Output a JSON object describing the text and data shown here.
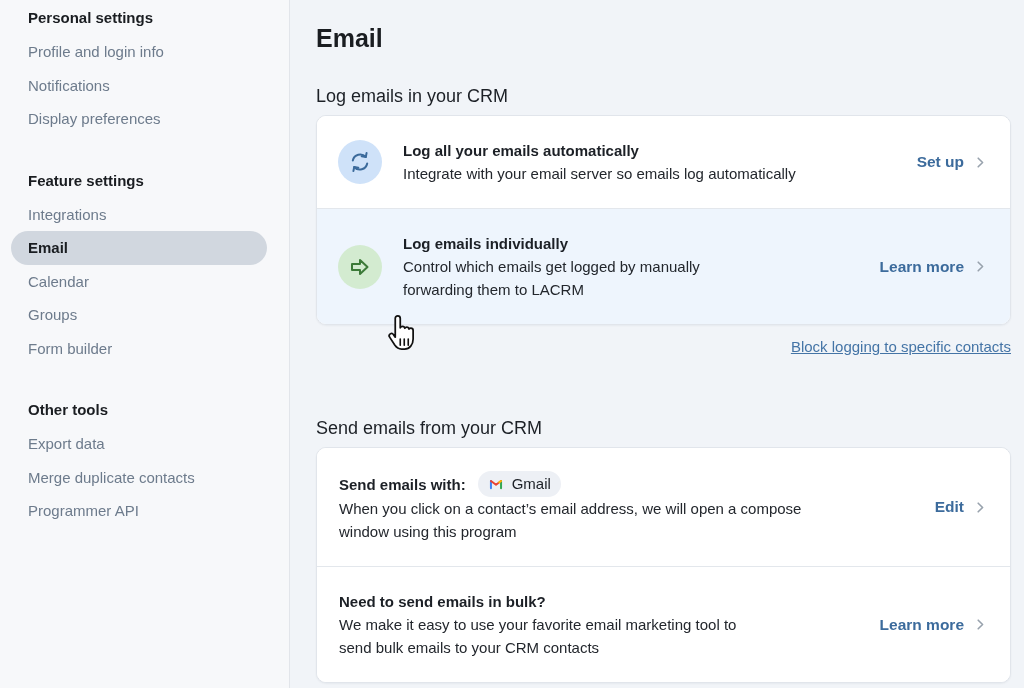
{
  "sidebar": {
    "groups": [
      {
        "heading": "Personal settings",
        "items": [
          {
            "label": "Profile and login info",
            "selected": false
          },
          {
            "label": "Notifications",
            "selected": false
          },
          {
            "label": "Display preferences",
            "selected": false
          }
        ]
      },
      {
        "heading": "Feature settings",
        "items": [
          {
            "label": "Integrations",
            "selected": false
          },
          {
            "label": "Email",
            "selected": true
          },
          {
            "label": "Calendar",
            "selected": false
          },
          {
            "label": "Groups",
            "selected": false
          },
          {
            "label": "Form builder",
            "selected": false
          }
        ]
      },
      {
        "heading": "Other tools",
        "items": [
          {
            "label": "Export data",
            "selected": false
          },
          {
            "label": "Merge duplicate contacts",
            "selected": false
          },
          {
            "label": "Programmer API",
            "selected": false
          }
        ]
      }
    ]
  },
  "page_title": "Email",
  "sections": [
    {
      "heading": "Log emails in your CRM",
      "rows": [
        {
          "title": "Log all your emails automatically",
          "description": "Integrate with your email server so emails log automatically",
          "action": "Set up",
          "hovered": false
        },
        {
          "title": "Log emails individually",
          "description": "Control which emails get logged by manually\nforwarding them to LACRM",
          "action": "Learn more",
          "hovered": true
        }
      ],
      "link": "Block logging to specific contacts"
    },
    {
      "heading": "Send emails from your CRM",
      "rows": [
        {
          "title": "Send emails with:",
          "chip": "Gmail",
          "description": "When you click on a contact’s email address, we will open a compose\nwindow using this program",
          "action": "Edit",
          "hovered": false
        },
        {
          "title": "Need to send emails in bulk?",
          "description": "We make it easy to use your favorite email marketing tool to\nsend bulk emails to your CRM contacts",
          "action": "Learn more",
          "hovered": false
        }
      ]
    }
  ]
}
